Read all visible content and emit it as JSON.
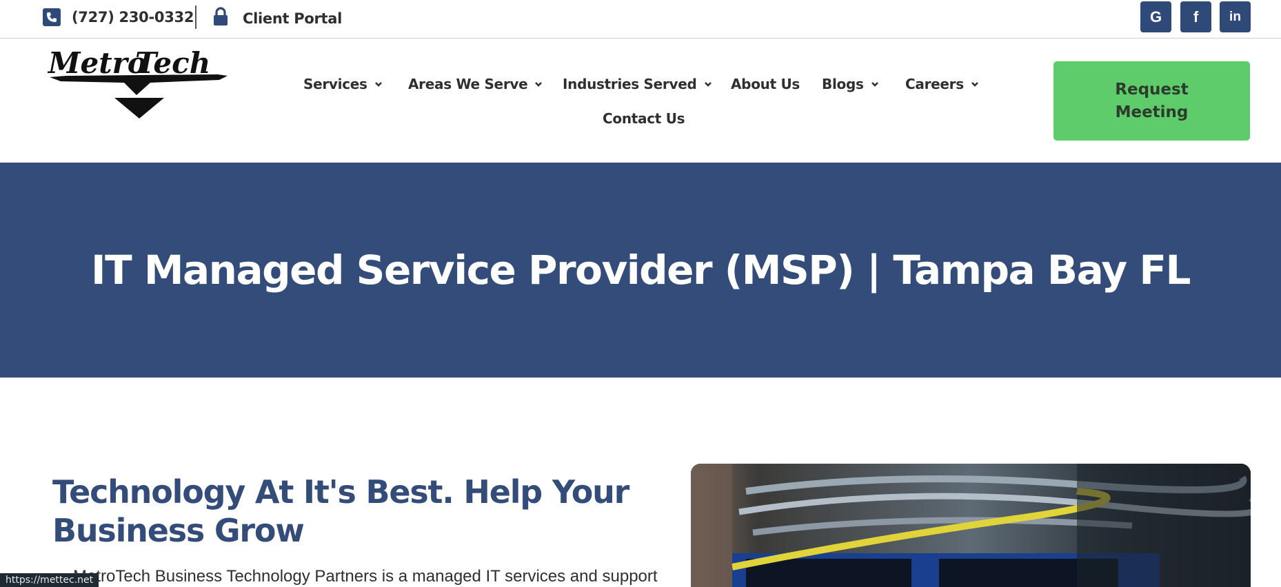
{
  "topbar": {
    "phone": "(727) 230-0332",
    "portal": "Client Portal",
    "social": [
      {
        "label": "G",
        "icon": "google-icon"
      },
      {
        "label": "f",
        "icon": "facebook-icon"
      },
      {
        "label": "in",
        "icon": "linkedin-icon"
      }
    ]
  },
  "nav": {
    "items": [
      "Services",
      "Areas We Serve",
      "Industries Served",
      "About Us",
      "Blogs",
      "Careers",
      "Contact Us"
    ]
  },
  "cta": {
    "label": "Request Meeting"
  },
  "hero": {
    "title": "IT Managed Service Provider (MSP) | Tampa Bay FL"
  },
  "content": {
    "heading": "Technology At It's Best. Help Your Business Grow",
    "paragraph": "MetroTech Business Technology Partners is a managed IT services and support"
  },
  "status": {
    "url": "https://mettec.net"
  },
  "colors": {
    "brand_blue": "#334c79",
    "cta_green": "#5fcc6b"
  }
}
